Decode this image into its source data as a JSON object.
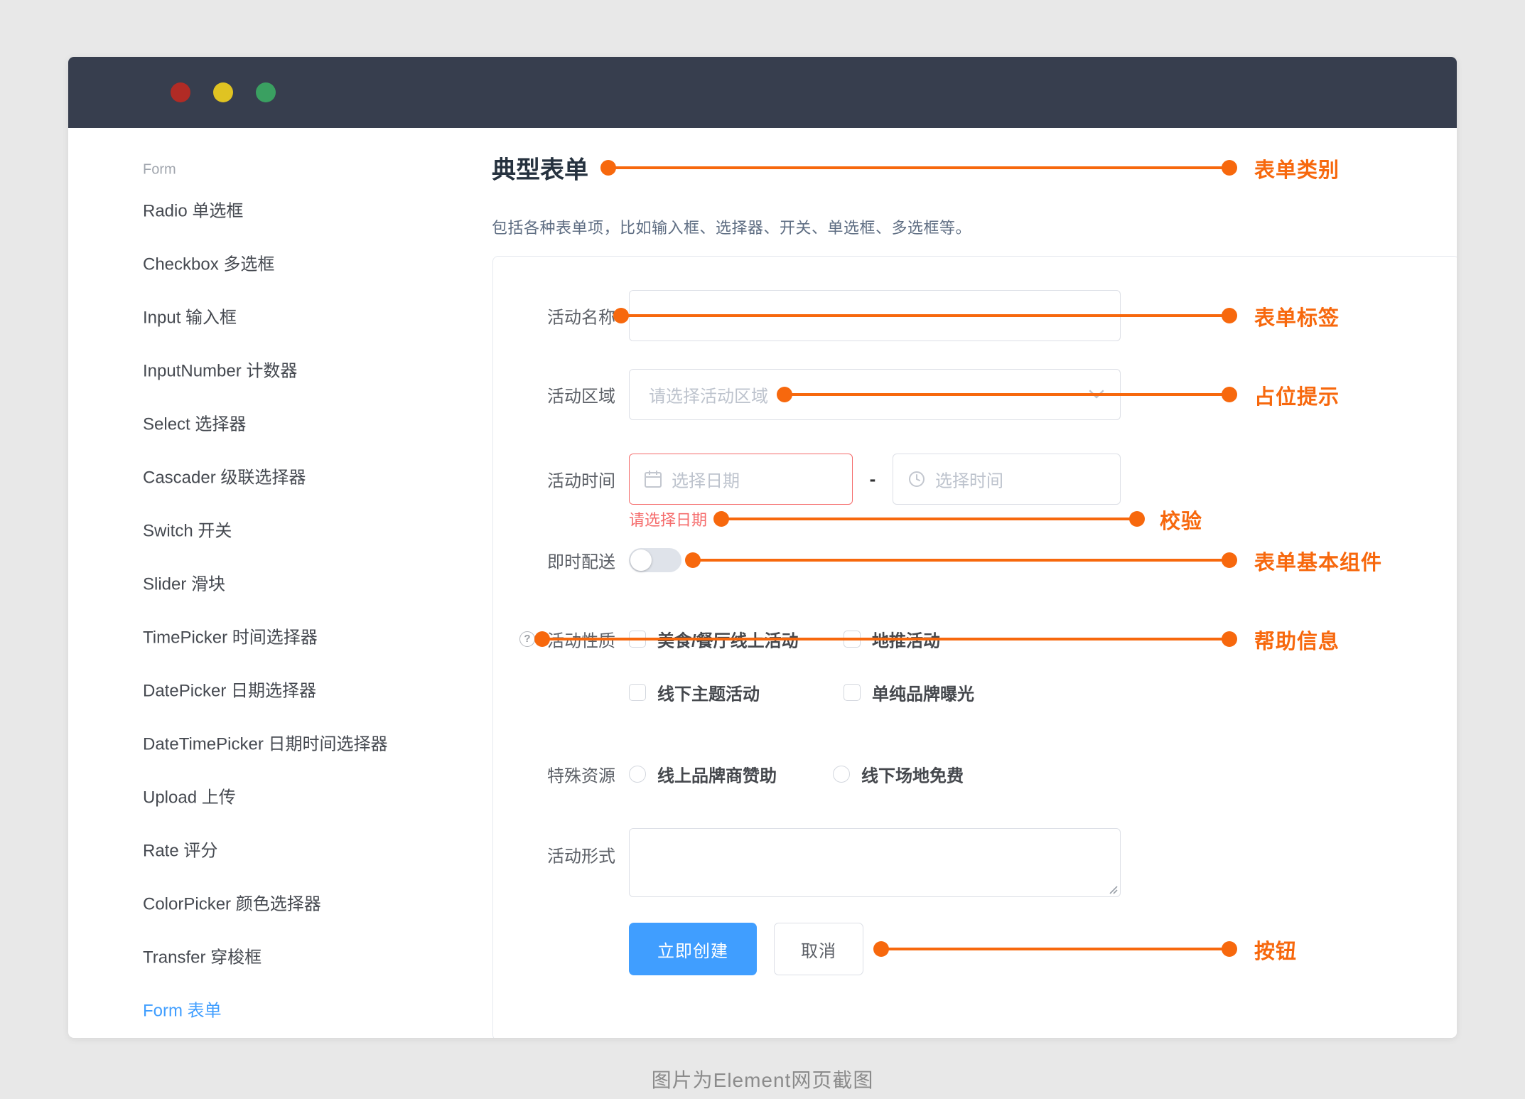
{
  "sidebar": {
    "section": "Form",
    "items": [
      {
        "label": "Radio 单选框",
        "active": false
      },
      {
        "label": "Checkbox 多选框",
        "active": false
      },
      {
        "label": "Input 输入框",
        "active": false
      },
      {
        "label": "InputNumber 计数器",
        "active": false
      },
      {
        "label": "Select 选择器",
        "active": false
      },
      {
        "label": "Cascader 级联选择器",
        "active": false
      },
      {
        "label": "Switch 开关",
        "active": false
      },
      {
        "label": "Slider 滑块",
        "active": false
      },
      {
        "label": "TimePicker 时间选择器",
        "active": false
      },
      {
        "label": "DatePicker 日期选择器",
        "active": false
      },
      {
        "label": "DateTimePicker 日期时间选择器",
        "active": false
      },
      {
        "label": "Upload 上传",
        "active": false
      },
      {
        "label": "Rate 评分",
        "active": false
      },
      {
        "label": "ColorPicker 颜色选择器",
        "active": false
      },
      {
        "label": "Transfer 穿梭框",
        "active": false
      },
      {
        "label": "Form 表单",
        "active": true
      }
    ]
  },
  "content": {
    "title": "典型表单",
    "description": "包括各种表单项，比如输入框、选择器、开关、单选框、多选框等。",
    "form": {
      "activity_name": {
        "label": "活动名称",
        "value": ""
      },
      "activity_zone": {
        "label": "活动区域",
        "placeholder": "请选择活动区域"
      },
      "activity_time": {
        "label": "活动时间",
        "date_placeholder": "选择日期",
        "time_placeholder": "选择时间",
        "separator": "-",
        "error": "请选择日期"
      },
      "instant_delivery": {
        "label": "即时配送",
        "state": "off"
      },
      "activity_nature": {
        "label": "活动性质",
        "options": [
          "美食/餐厅线上活动",
          "地推活动",
          "线下主题活动",
          "单纯品牌曝光"
        ]
      },
      "special_resources": {
        "label": "特殊资源",
        "options": [
          "线上品牌商赞助",
          "线下场地免费"
        ]
      },
      "activity_form": {
        "label": "活动形式",
        "value": ""
      },
      "buttons": {
        "create": "立即创建",
        "cancel": "取消"
      }
    }
  },
  "annotations": {
    "items": [
      {
        "label": "表单类别"
      },
      {
        "label": "表单标签"
      },
      {
        "label": "占位提示"
      },
      {
        "label": "校验"
      },
      {
        "label": "表单基本组件"
      },
      {
        "label": "帮助信息"
      },
      {
        "label": "按钮"
      }
    ]
  },
  "caption": "图片为Element网页截图",
  "colors": {
    "accent_orange": "#f7680d",
    "primary_blue": "#409eff",
    "error_red": "#f56c6c",
    "titlebar": "#373e4e"
  }
}
